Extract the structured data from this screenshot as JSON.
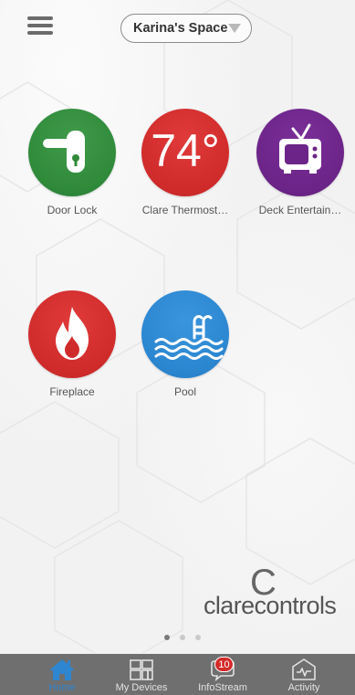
{
  "header": {
    "menu_icon": "hamburger-menu-icon",
    "space_selector": {
      "value": "Karina's Space",
      "icon": "chevron-down-icon"
    }
  },
  "devices": [
    {
      "id": "door-lock",
      "label": "Door Lock",
      "icon": "door-lock-icon",
      "color": "#2f8a3a"
    },
    {
      "id": "thermostat",
      "label": "Clare Thermost…",
      "icon": "thermostat-icon",
      "display": "74°",
      "color": "#d02b2b"
    },
    {
      "id": "deck-entertainment",
      "label": "Deck Entertain…",
      "icon": "tv-icon",
      "color": "#6c2488"
    },
    {
      "id": "fireplace",
      "label": "Fireplace",
      "icon": "flame-icon",
      "color": "#d02b2b"
    },
    {
      "id": "pool",
      "label": "Pool",
      "icon": "pool-icon",
      "color": "#2b86d0"
    }
  ],
  "brand": {
    "logo_mark": "C",
    "wordmark": "clarecontrols"
  },
  "pager": {
    "pages": 3,
    "current": 1
  },
  "tabbar": {
    "tabs": [
      {
        "label": "Home",
        "icon": "home-icon",
        "active": true
      },
      {
        "label": "My Devices",
        "icon": "devices-grid-icon",
        "active": false
      },
      {
        "label": "InfoStream",
        "icon": "chat-bubble-icon",
        "active": false,
        "badge": "10"
      },
      {
        "label": "Activity",
        "icon": "activity-icon",
        "active": false
      }
    ]
  },
  "colors": {
    "tabbar_bg": "#6f6f6f",
    "accent": "#2f86d0",
    "badge": "#d42a2a"
  }
}
